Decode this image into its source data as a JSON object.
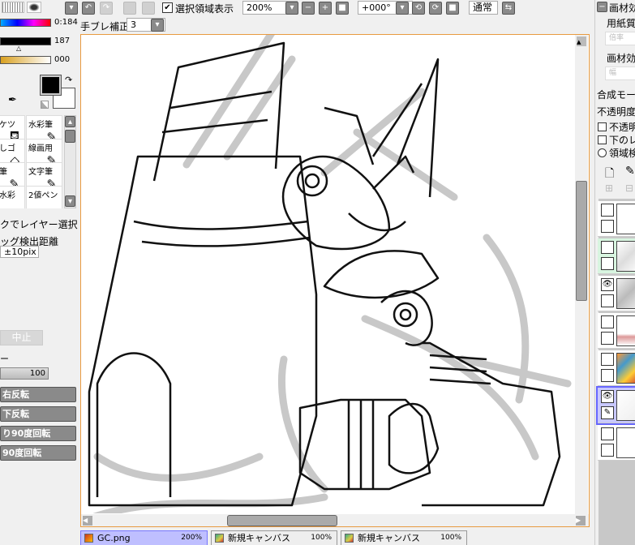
{
  "toolbar": {
    "show_selection_label": "選択領域表示",
    "show_selection_checked": true,
    "zoom": "200%",
    "rotation": "+000°",
    "blend_mode": "通常",
    "stabilizer_label": "手ブレ補正",
    "stabilizer_value": "3"
  },
  "color": {
    "hue_value": "0:184",
    "bar2_value": "187",
    "bar3_value": "000",
    "primary": "#000000",
    "secondary": "#ffffff"
  },
  "tools": [
    {
      "label": "バケツ",
      "icon": "bucket-icon"
    },
    {
      "label": "水彩筆",
      "icon": "watercolor-icon"
    },
    {
      "label": "消しゴム",
      "icon": "eraser-icon"
    },
    {
      "label": "線画用",
      "icon": "pen-icon"
    },
    {
      "label": "鉛筆",
      "icon": "pencil-icon"
    },
    {
      "label": "文字筆",
      "icon": "pen-icon"
    },
    {
      "label": "旧水彩",
      "icon": "brush-icon"
    },
    {
      "label": "2値ペン",
      "icon": "binary-pen-icon"
    }
  ],
  "options": {
    "layer_select_label": "クでレイヤー選択",
    "drag_detect_label": "ッグ検出距離",
    "drag_detect_value": "±10pix"
  },
  "transform": {
    "cancel": "中止",
    "label": "ー",
    "value": "100",
    "buttons": [
      "右反転",
      "下反転",
      "り90度回転",
      "90度回転"
    ]
  },
  "right_panel": {
    "texture_header": "画材効",
    "paper_label": "用紙質",
    "scale_placeholder": "倍率",
    "effect_label": "画材効",
    "width_placeholder": "幅",
    "blend_label": "合成モード",
    "opacity_label": "不透明度",
    "check1": "不透明",
    "check2": "下のレ",
    "radio": "領域検"
  },
  "layers": [
    {
      "visible": false,
      "selected": false
    },
    {
      "visible": false,
      "selected": false,
      "highlight": true
    },
    {
      "visible": true,
      "selected": false
    },
    {
      "visible": false,
      "selected": false
    },
    {
      "visible": false,
      "selected": false
    },
    {
      "visible": true,
      "selected": true
    },
    {
      "visible": false,
      "selected": false
    }
  ],
  "tabs": [
    {
      "name": "GC.png",
      "zoom": "200%",
      "active": true
    },
    {
      "name": "新規キャンバス",
      "zoom": "100%",
      "active": false
    },
    {
      "name": "新規キャンバス",
      "zoom": "100%",
      "active": false
    }
  ]
}
